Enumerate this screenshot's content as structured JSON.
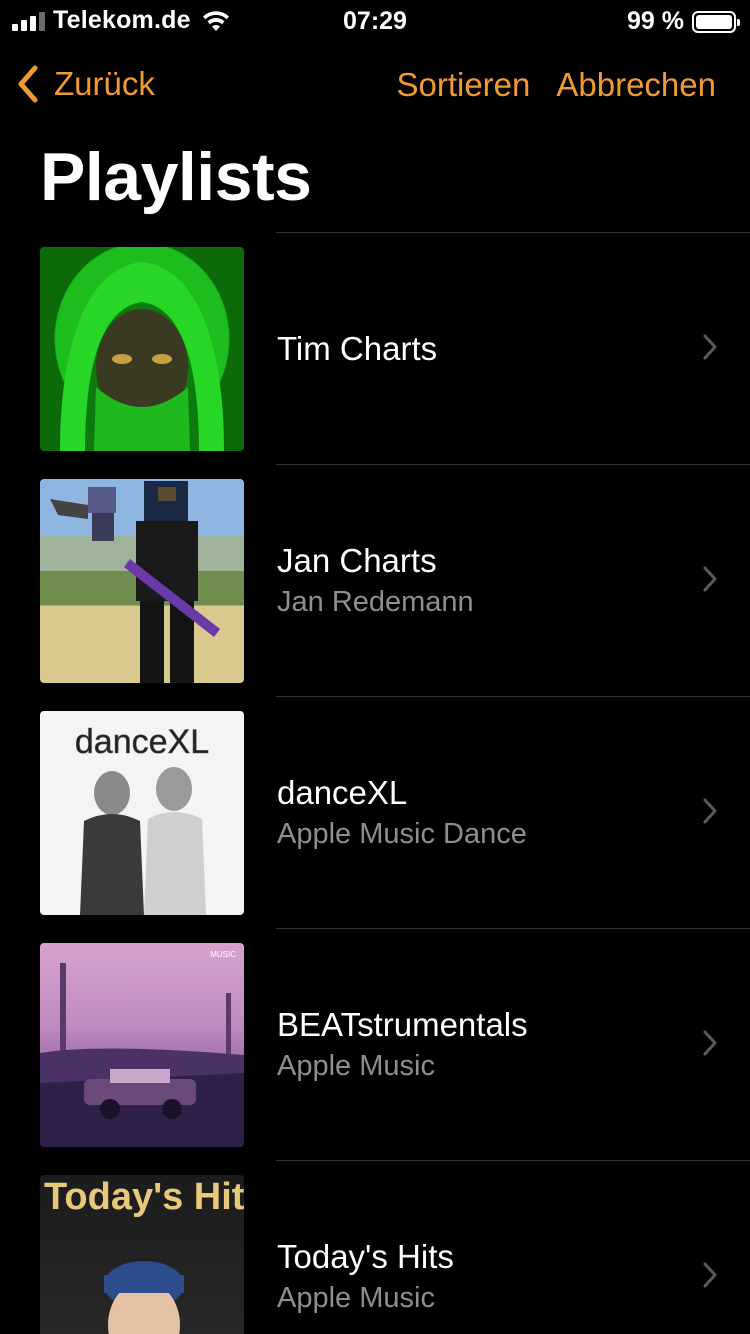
{
  "status_bar": {
    "carrier": "Telekom.de",
    "time": "07:29",
    "battery": "99 %"
  },
  "nav": {
    "back_label": "Zurück",
    "sort_label": "Sortieren",
    "cancel_label": "Abbrechen"
  },
  "page_title": "Playlists",
  "accent_color": "#f29a32",
  "playlists": [
    {
      "name": "Tim Charts",
      "subtitle": ""
    },
    {
      "name": "Jan Charts",
      "subtitle": "Jan Redemann"
    },
    {
      "name": "danceXL",
      "subtitle": "Apple Music Dance",
      "art_text": "danceXL"
    },
    {
      "name": "BEATstrumentals",
      "subtitle": "Apple Music",
      "art_text": "MUSIC"
    },
    {
      "name": "Today's Hits",
      "subtitle": "Apple Music",
      "art_text": "Today's Hits"
    }
  ]
}
